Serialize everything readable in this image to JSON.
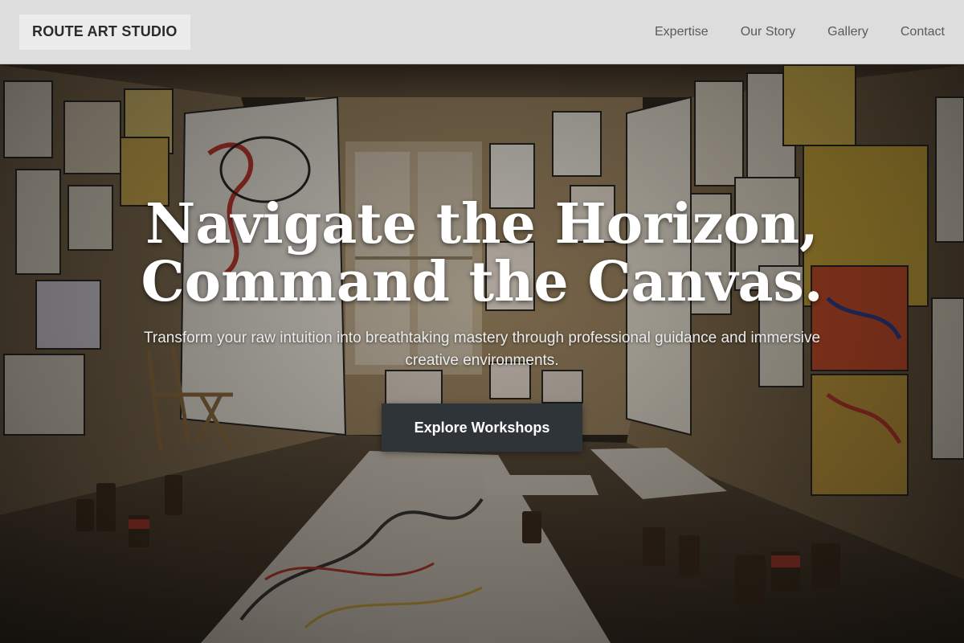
{
  "brand": {
    "name": "ROUTE ART STUDIO"
  },
  "nav": {
    "links": [
      "Expertise",
      "Our Story",
      "Gallery",
      "Contact"
    ]
  },
  "hero": {
    "headline_line1": "Navigate the Horizon,",
    "headline_line2": "Command the Canvas.",
    "subtitle": "Transform your raw intuition into breathtaking mastery through professional guidance and immersive creative environments.",
    "cta_label": "Explore Workshops",
    "background_icon": "art-studio-photo"
  },
  "colors": {
    "navbar_bg": "#dddddd",
    "logo_bg": "#ececec",
    "cta_bg": "#2f3438",
    "headline": "#ffffff"
  }
}
